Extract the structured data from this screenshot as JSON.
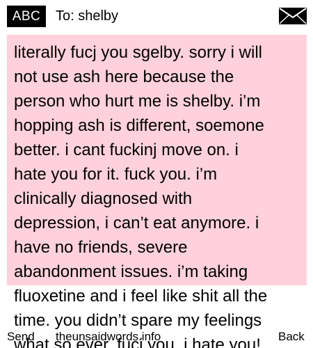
{
  "header": {
    "mode_label": "ABC",
    "to_label": "To: shelby"
  },
  "message": {
    "lines": [
      "literally fucj you sgelby. sorry i will",
      "not use ash here because the",
      "person who hurt me is shelby. i’m",
      "hopping ash is different, soemone",
      "better. i cant fuckinj move on. i",
      "hate you for it. fuck you. i’m",
      "clinically diagnosed with",
      "depression, i can’t eat anymore. i",
      "have no friends, severe",
      "abandonment issues. i’m taking",
      "fluoxetine and i feel like shit all the",
      "time. you didn’t spare my feelings",
      "what so ever. fucj you. i hate you!"
    ]
  },
  "softkeys": {
    "left": "Send",
    "center": "theunsaidwords.info",
    "right": "Back"
  },
  "icons": {
    "envelope": "envelope-icon"
  },
  "colors": {
    "message_background": "#ffd1dc",
    "badge_background": "#000000"
  }
}
